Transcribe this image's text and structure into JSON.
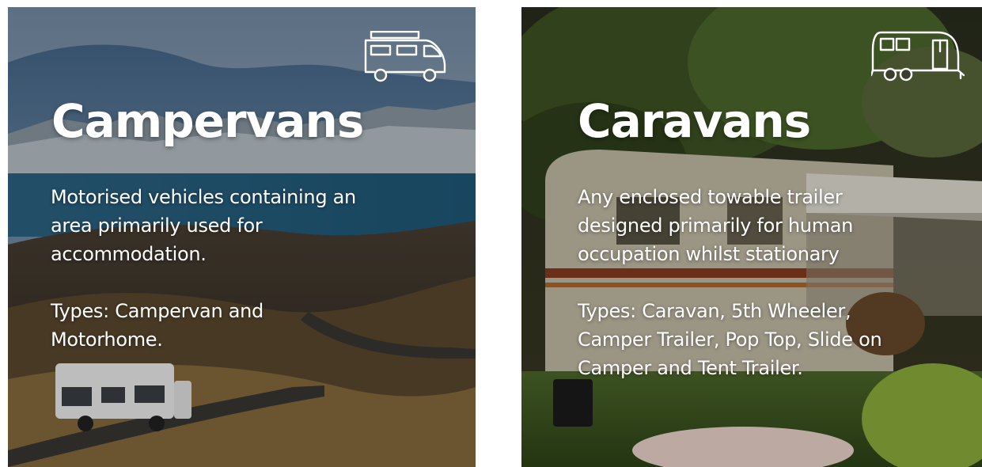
{
  "cards": [
    {
      "title": "Campervans",
      "description": "Motorised vehicles containing an area primarily used for accommodation.",
      "types": "Types: Campervan and Motorhome.",
      "icon": "campervan-icon",
      "background": "mountain-road-landscape-photo"
    },
    {
      "title": "Caravans",
      "description": "Any enclosed towable trailer designed primarily for human occupation whilst stationary",
      "types": "Types: Caravan, 5th Wheeler, Camper Trailer, Pop Top, Slide on Camper and Tent Trailer.",
      "icon": "caravan-icon",
      "background": "parked-caravan-garden-photo"
    }
  ],
  "colors": {
    "text": "#ffffff",
    "sky": "#5d7fa3",
    "lake": "#3b7596",
    "hills": "#6b5a3e",
    "foliage": "#2f3d1f",
    "caravan_body": "#cfc6b0"
  }
}
